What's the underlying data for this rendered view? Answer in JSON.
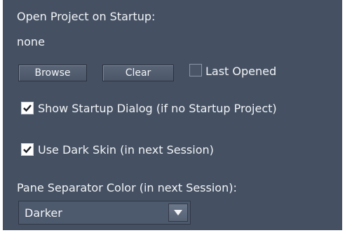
{
  "startup": {
    "open_project_label": "Open Project on Startup:",
    "project_value": "none",
    "browse_label": "Browse",
    "clear_label": "Clear",
    "last_opened_label": "Last Opened",
    "last_opened_checked": false
  },
  "options": {
    "show_startup_dialog_label": "Show Startup Dialog (if no Startup Project)",
    "show_startup_dialog_checked": true,
    "dark_skin_label": "Use Dark Skin (in next Session)",
    "dark_skin_checked": true
  },
  "separator": {
    "label": "Pane Separator Color (in next Session):",
    "selected": "Darker"
  },
  "colors": {
    "panel_background": "#455163",
    "text": "#f2f4f7"
  },
  "icons": {
    "checkmark": "checkmark-icon",
    "dropdown": "chevron-down-icon"
  }
}
